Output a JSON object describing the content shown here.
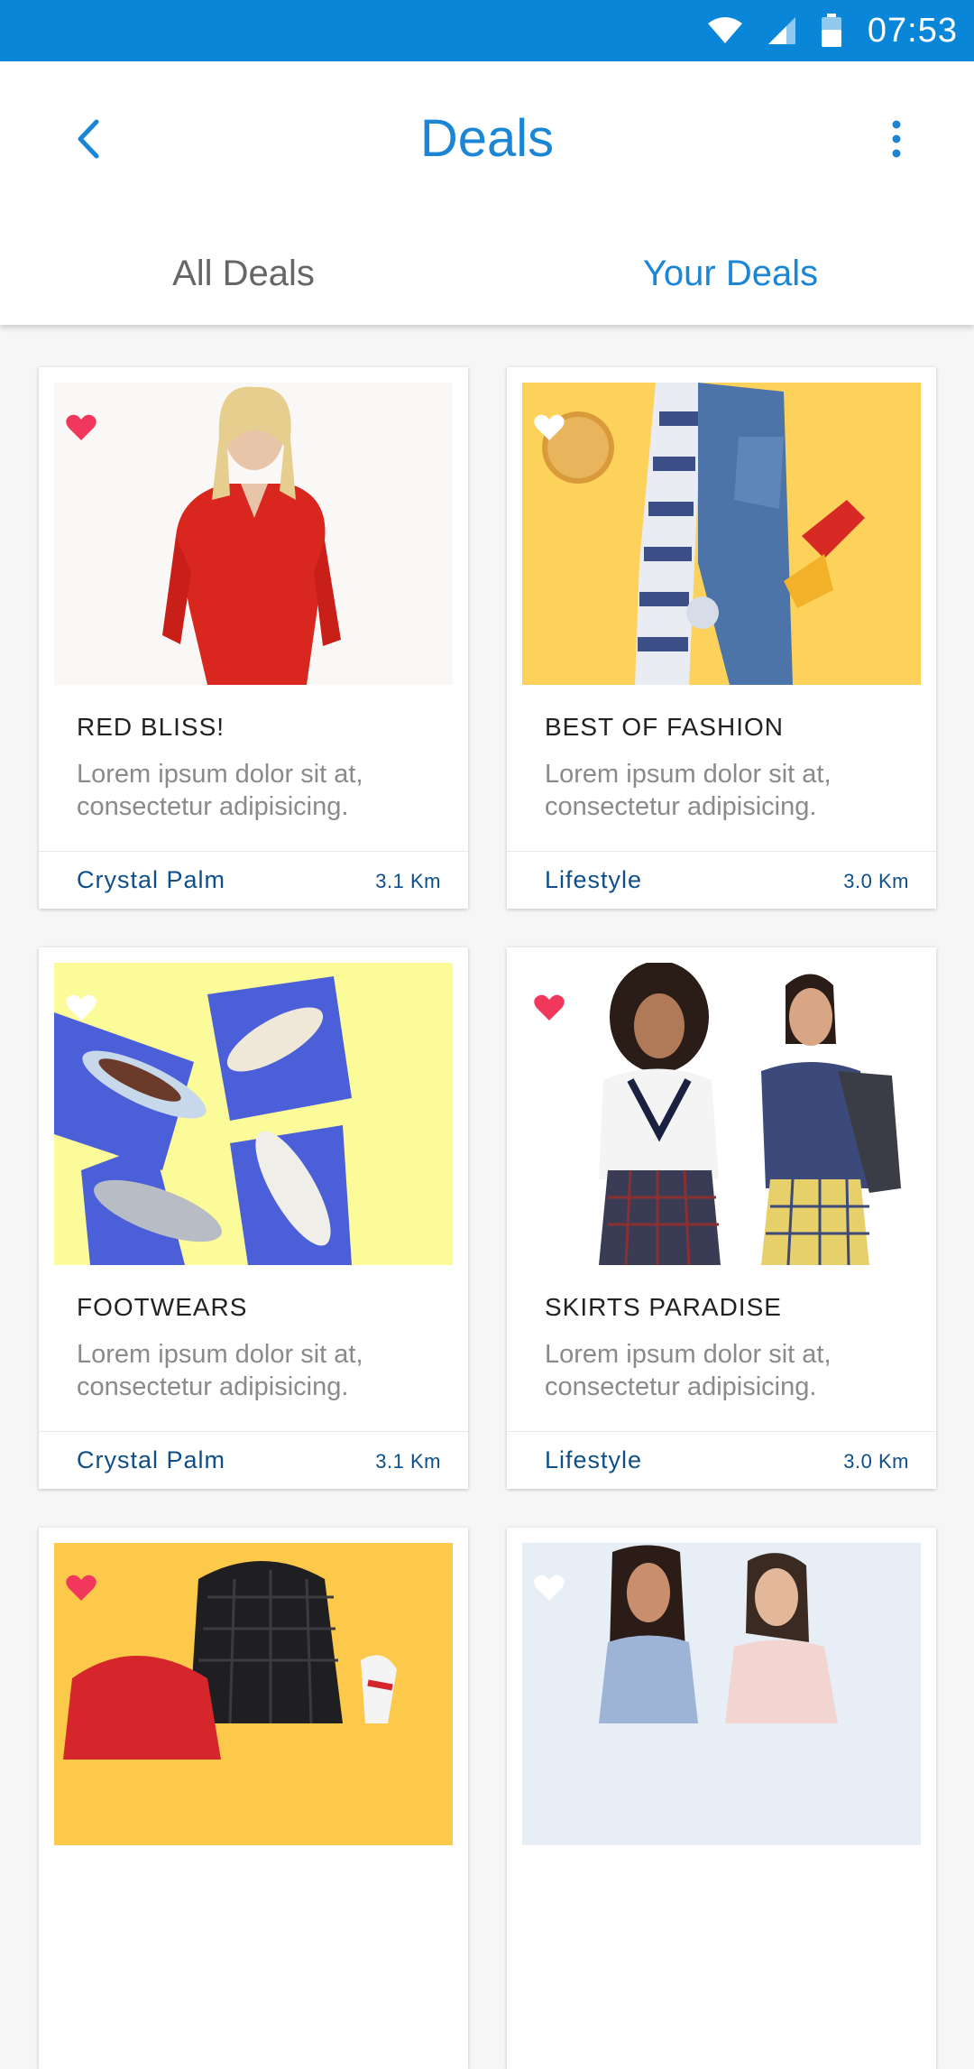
{
  "status_bar": {
    "time": "07:53",
    "icons": [
      "wifi-icon",
      "signal-icon",
      "battery-icon"
    ]
  },
  "header": {
    "title": "Deals",
    "back_icon": "chevron-left-icon",
    "more_icon": "more-vertical-icon"
  },
  "tabs": [
    {
      "label": "All Deals",
      "active": false
    },
    {
      "label": "Your Deals",
      "active": true
    }
  ],
  "colors": {
    "accent": "#1c86d6",
    "status_bar": "#0a86d9",
    "heart_active": "#f2375c",
    "store_text": "#0e4f8a"
  },
  "deals": [
    {
      "title": "RED BLISS!",
      "description": "Lorem ipsum dolor sit at, consectetur adipisicing.",
      "store": "Crystal Palm",
      "distance": "3.1 Km",
      "favorite": true
    },
    {
      "title": "BEST OF FASHION",
      "description": "Lorem ipsum dolor sit at, consectetur adipisicing.",
      "store": "Lifestyle",
      "distance": "3.0 Km",
      "favorite": false
    },
    {
      "title": "FOOTWEARS",
      "description": "Lorem ipsum dolor sit at, consectetur adipisicing.",
      "store": "Crystal Palm",
      "distance": "3.1 Km",
      "favorite": false
    },
    {
      "title": "SKIRTS PARADISE",
      "description": "Lorem ipsum dolor sit at, consectetur adipisicing.",
      "store": "Lifestyle",
      "distance": "3.0 Km",
      "favorite": true
    },
    {
      "title": "",
      "description": "",
      "store": "",
      "distance": "",
      "favorite": true
    },
    {
      "title": "",
      "description": "",
      "store": "",
      "distance": "",
      "favorite": false
    }
  ]
}
